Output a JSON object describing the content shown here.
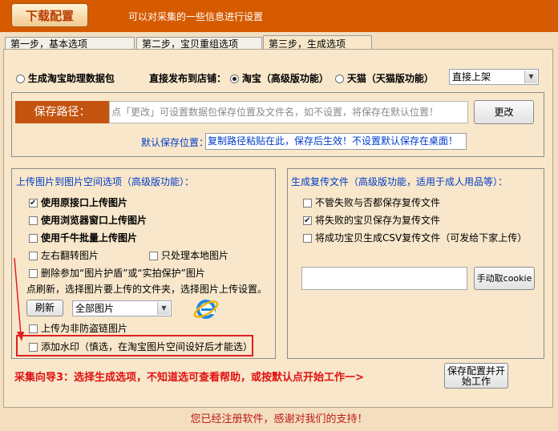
{
  "header": {
    "title": "下载配置",
    "description": "可以对采集的一些信息进行设置"
  },
  "tabs": [
    "第一步，基本选项",
    "第二步，宝贝重组选项",
    "第三步，生成选项"
  ],
  "publish": {
    "radio_package": "生成淘宝助理数据包",
    "direct_label": "直接发布到店铺：",
    "radio_taobao": "淘宝（高级版功能）",
    "radio_tmall": "天猫（天猫版功能）",
    "shelf_value": "直接上架"
  },
  "save_path": {
    "label": "保存路径：",
    "placeholder": "点「更改」可设置数据包保存位置及文件名，如不设置，将保存在默认位置！",
    "change_button": "更改",
    "default_label": "默认保存位置：",
    "default_value": "复制路径粘贴在此，保存后生效！不设置默认保存在桌面！"
  },
  "upload": {
    "title": "上传图片到图片空间选项（高级版功能）：",
    "opt_original": "使用原接口上传图片",
    "opt_browser": "使用浏览器窗口上传图片",
    "opt_qianniu": "使用千牛批量上传图片",
    "opt_flip": "左右翻转图片",
    "opt_local_only": "只处理本地图片",
    "opt_delete_protect": "删除参加“图片护盾”或“实拍保护”图片",
    "refresh_hint": "点刷新，选择图片要上传的文件夹，选择图片上传设置。",
    "refresh_button": "刷新",
    "folder_value": "全部图片",
    "opt_anti_leech": "上传为非防盗链图片",
    "opt_watermark": "添加水印（慎选，在淘宝图片空间设好后才能选）"
  },
  "repost": {
    "title": "生成复传文件（高级版功能，适用于成人用品等）：",
    "opt_all": "不管失败与否都保存复传文件",
    "opt_failed": "将失败的宝贝保存为复传文件",
    "opt_success_csv": "将成功宝贝生成CSV复传文件（可发给下家上传）",
    "cookie_button": "手动取cookie"
  },
  "guide": {
    "text": "采集向导3：选择生成选项，不知道选可查看帮助，或按默认点开始工作一>",
    "start_button": "保存配置并开始工作"
  },
  "footer": {
    "text": "您已经注册软件，感谢对我们的支持！"
  },
  "colors": {
    "header": "#d65a00",
    "panel": "#f8e7ca",
    "guide_red": "#e01010",
    "blue_text": "#003dc8",
    "highlight": "#e02020"
  }
}
